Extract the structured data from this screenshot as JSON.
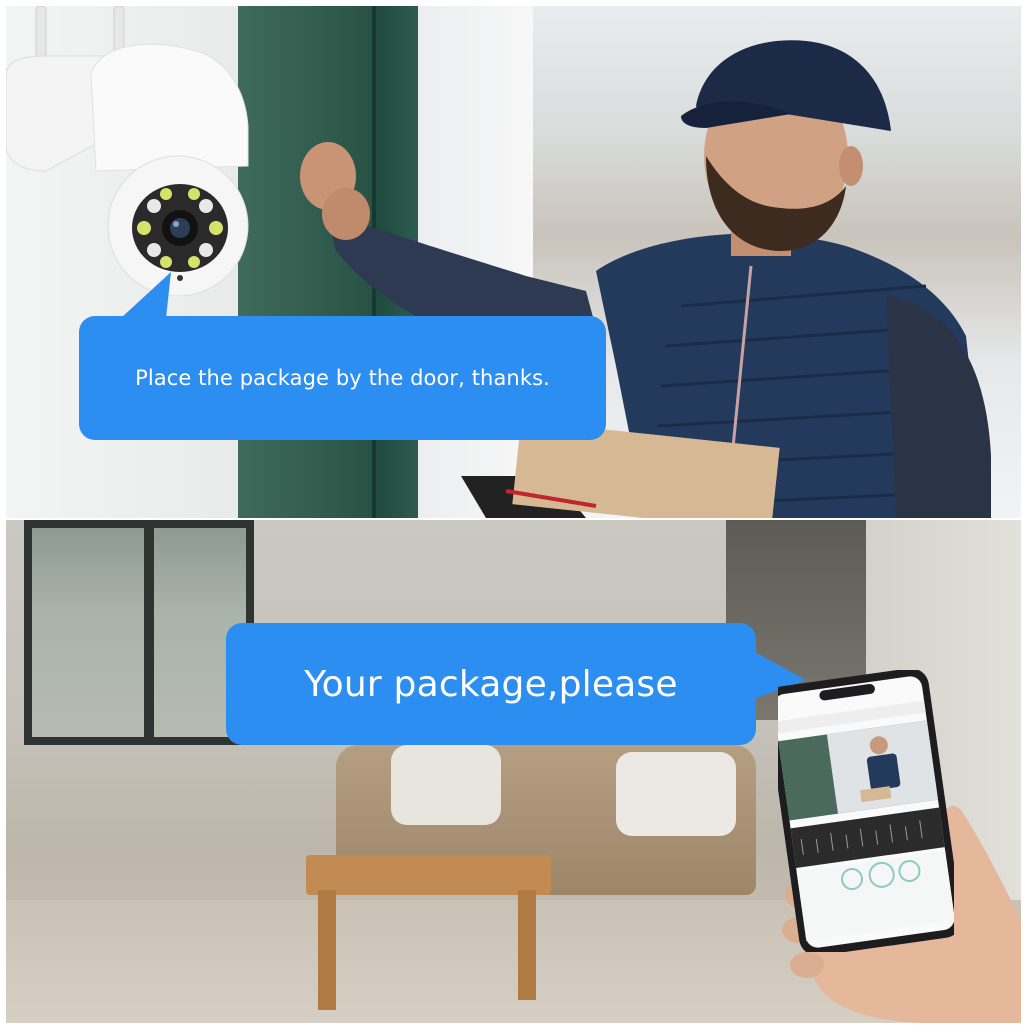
{
  "top_caption": "Place the package by the door, thanks.",
  "bottom_caption": "Your package,please",
  "colors": {
    "bubble": "#2d8ef2",
    "bubble_text": "#ffffff",
    "door_green": "#2c5749",
    "vest_navy": "#1f3656"
  },
  "icons": {
    "camera": "security-camera",
    "phone": "smartphone",
    "phone_buttons": [
      "camera-icon",
      "microphone-icon",
      "video-icon"
    ]
  }
}
